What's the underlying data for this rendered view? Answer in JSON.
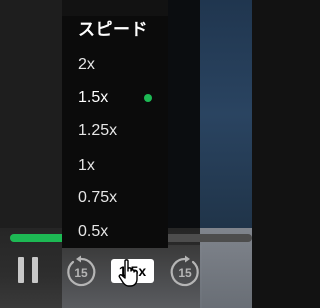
{
  "speed_menu": {
    "title": "スピード",
    "options": [
      {
        "label": "2x",
        "selected": false
      },
      {
        "label": "1.5x",
        "selected": true
      },
      {
        "label": "1.25x",
        "selected": false
      },
      {
        "label": "1x",
        "selected": false
      },
      {
        "label": "0.75x",
        "selected": false
      },
      {
        "label": "0.5x",
        "selected": false
      }
    ]
  },
  "playback": {
    "speed_button_label": "1.5x",
    "rewind_seconds": "15",
    "forward_seconds": "15",
    "progress_fraction": 0.25
  },
  "colors": {
    "accent": "#1db954",
    "menu_background": "#0b0b0b",
    "control_gray": "#c8c8c8"
  },
  "icons": {
    "pause": "pause-icon",
    "rewind": "rewind-15-icon",
    "forward": "forward-15-icon",
    "cursor": "hand-pointer-cursor-icon"
  }
}
